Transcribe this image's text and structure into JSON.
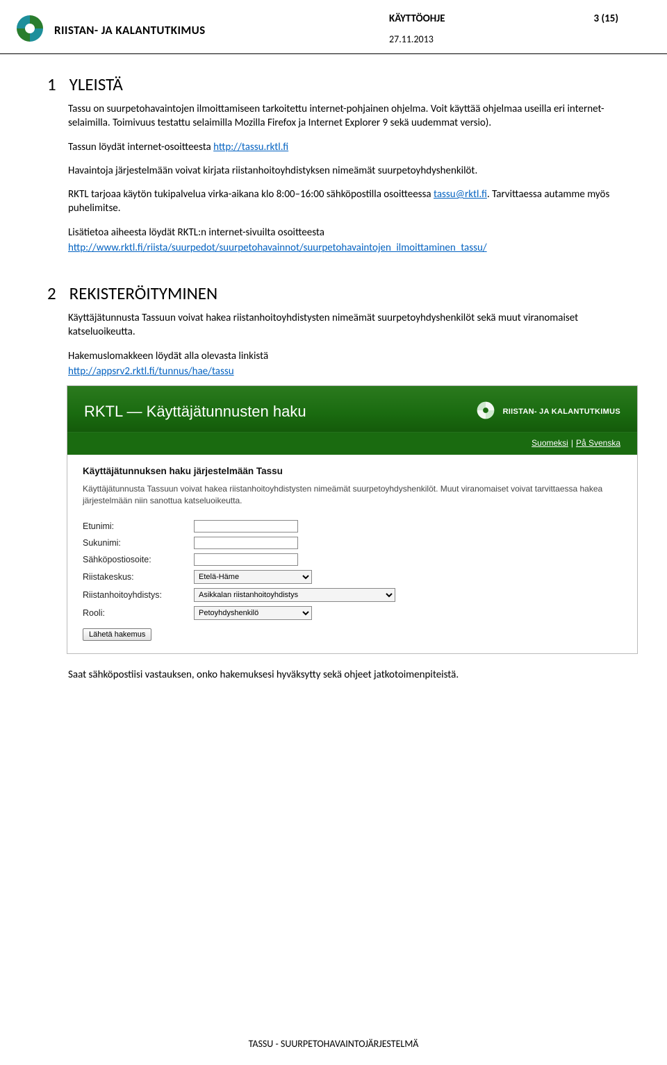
{
  "header": {
    "org_name": "RIISTAN- JA KALANTUTKIMUS",
    "doc_type": "KÄYTTÖOHJE",
    "page_label": "3 (15)",
    "date": "27.11.2013"
  },
  "section1": {
    "number": "1",
    "title": "YLEISTÄ",
    "p1": "Tassu on suurpetohavaintojen ilmoittamiseen tarkoitettu internet-pohjainen ohjelma. Voit käyttää ohjelmaa useilla eri internet-selaimilla. Toimivuus testattu selaimilla Mozilla Firefox ja Internet Explorer 9 sekä uudemmat versio).",
    "p2a": "Tassun löydät internet-osoitteesta ",
    "link1": "http://tassu.rktl.fi",
    "p3": "Havaintoja järjestelmään voivat kirjata riistanhoitoyhdistyksen nimeämät suurpetoyhdyshenkilöt.",
    "p4a": "RKTL tarjoaa käytön tukipalvelua virka-aikana klo 8:00–16:00 sähköpostilla osoitteessa ",
    "link2": "tassu@rktl.fi",
    "p4b": ". Tarvittaessa autamme myös puhelimitse.",
    "p5a": "Lisätietoa aiheesta löydät RKTL:n internet-sivuilta osoitteesta",
    "link3": "http://www.rktl.fi/riista/suurpedot/suurpetohavainnot/suurpetohavaintojen_ilmoittaminen_tassu/"
  },
  "section2": {
    "number": "2",
    "title": "REKISTERÖITYMINEN",
    "p1": "Käyttäjätunnusta Tassuun voivat hakea riistanhoitoyhdistysten nimeämät suurpetoyhdyshenkilöt sekä muut viranomaiset katseluoikeutta.",
    "p2": "Hakemuslomakkeen löydät alla olevasta linkistä",
    "link1": "http://appsrv2.rktl.fi/tunnus/hae/tassu",
    "p_after": "Saat sähköpostiisi vastauksen, onko hakemuksesi hyväksytty sekä ohjeet jatkotoimenpiteistä."
  },
  "screenshot": {
    "title": "RKTL — Käyttäjätunnusten haku",
    "logo_text": "RIISTAN- JA KALANTUTKIMUS",
    "lang_fi": "Suomeksi",
    "lang_sv": "På Svenska",
    "subtitle": "Käyttäjätunnuksen haku järjestelmään Tassu",
    "desc": "Käyttäjätunnusta Tassuun voivat hakea riistanhoitoyhdistysten nimeämät suurpetoyhdyshenkilöt. Muut viranomaiset voivat tarvittaessa hakea järjestelmään niin sanottua katseluoikeutta.",
    "labels": {
      "firstname": "Etunimi:",
      "lastname": "Sukunimi:",
      "email": "Sähköpostiosoite:",
      "center": "Riistakeskus:",
      "association": "Riistanhoitoyhdistys:",
      "role": "Rooli:"
    },
    "values": {
      "firstname": "",
      "lastname": "",
      "email": "",
      "center": "Etelä-Häme",
      "association": "Asikkalan riistanhoitoyhdistys",
      "role": "Petoyhdyshenkilö"
    },
    "submit": "Lähetä hakemus"
  },
  "footer": "TASSU - SUURPETOHAVAINTOJÄRJESTELMÄ"
}
